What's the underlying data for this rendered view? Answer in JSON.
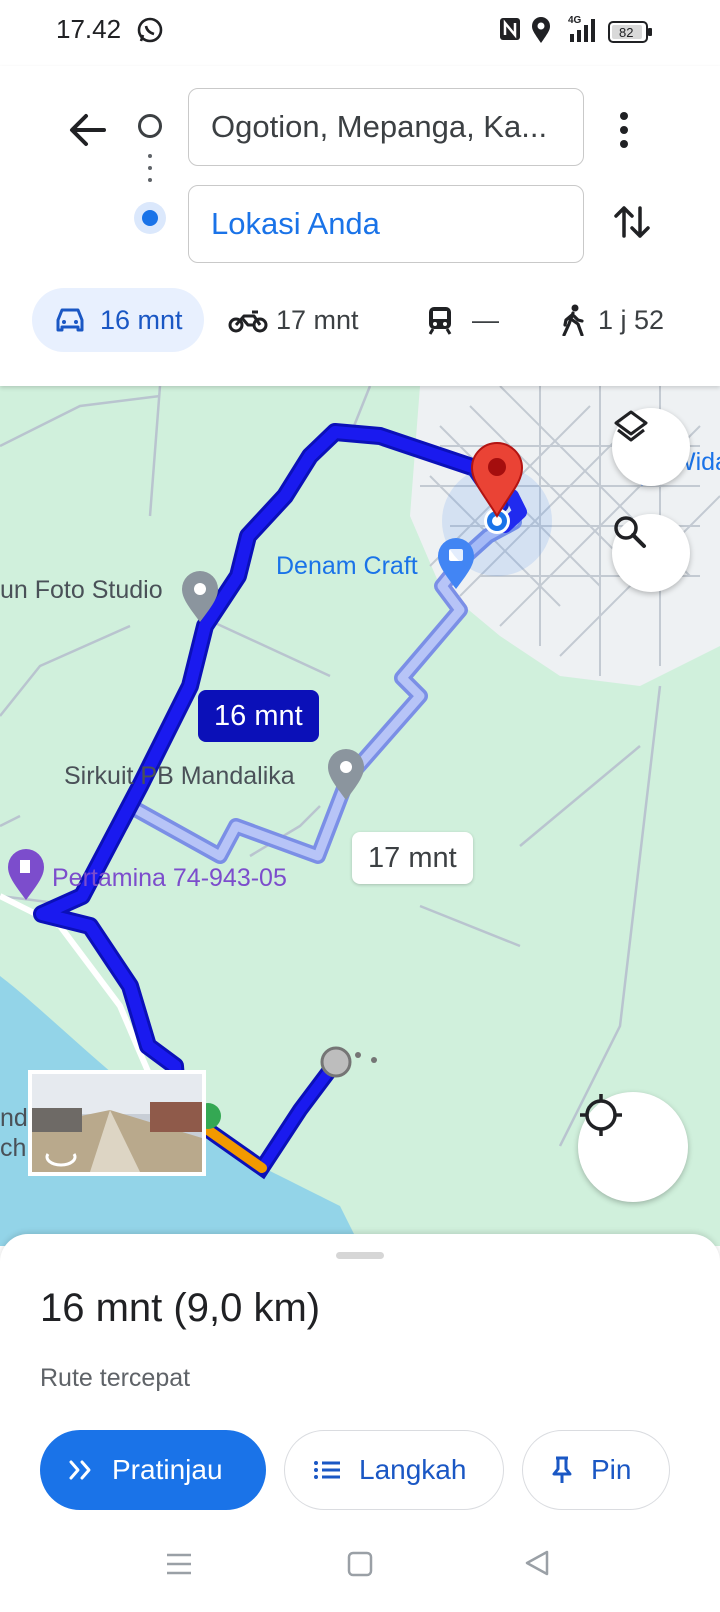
{
  "status_bar": {
    "time": "17.42",
    "battery": "82",
    "network": "4G"
  },
  "directions": {
    "origin": "Ogotion, Mepanga, Ka...",
    "destination": "Lokasi Anda",
    "modes": [
      {
        "label": "16 mnt",
        "icon": "car-icon",
        "active": true
      },
      {
        "label": "17 mnt",
        "icon": "motorcycle-icon",
        "active": false
      },
      {
        "label": "—",
        "icon": "train-icon",
        "active": false
      },
      {
        "label": "1 j 52",
        "icon": "walk-icon",
        "active": false
      }
    ]
  },
  "map": {
    "places": {
      "foto_studio": "un Foto Studio",
      "denam_craft": "Denam Craft",
      "sirkuit": "Sirkuit PB Mandalika",
      "pertamina": "Pertamina 74-943-05",
      "wida": "Wida",
      "beach_1": "nd",
      "beach_2": "ch"
    },
    "route_times": {
      "primary": "16 mnt",
      "alternate": "17 mnt"
    }
  },
  "sheet": {
    "summary": "16 mnt (9,0 km)",
    "subtitle": "Rute tercepat",
    "buttons": {
      "preview": "Pratinjau",
      "steps": "Langkah",
      "pin": "Pin"
    }
  },
  "colors": {
    "route_primary": "#1a1aef",
    "route_alternate": "#9aa9f3",
    "accent": "#1a73e8",
    "map_land": "#d0f0dc",
    "map_water": "#93d4e8",
    "marker_red": "#ea4335"
  }
}
